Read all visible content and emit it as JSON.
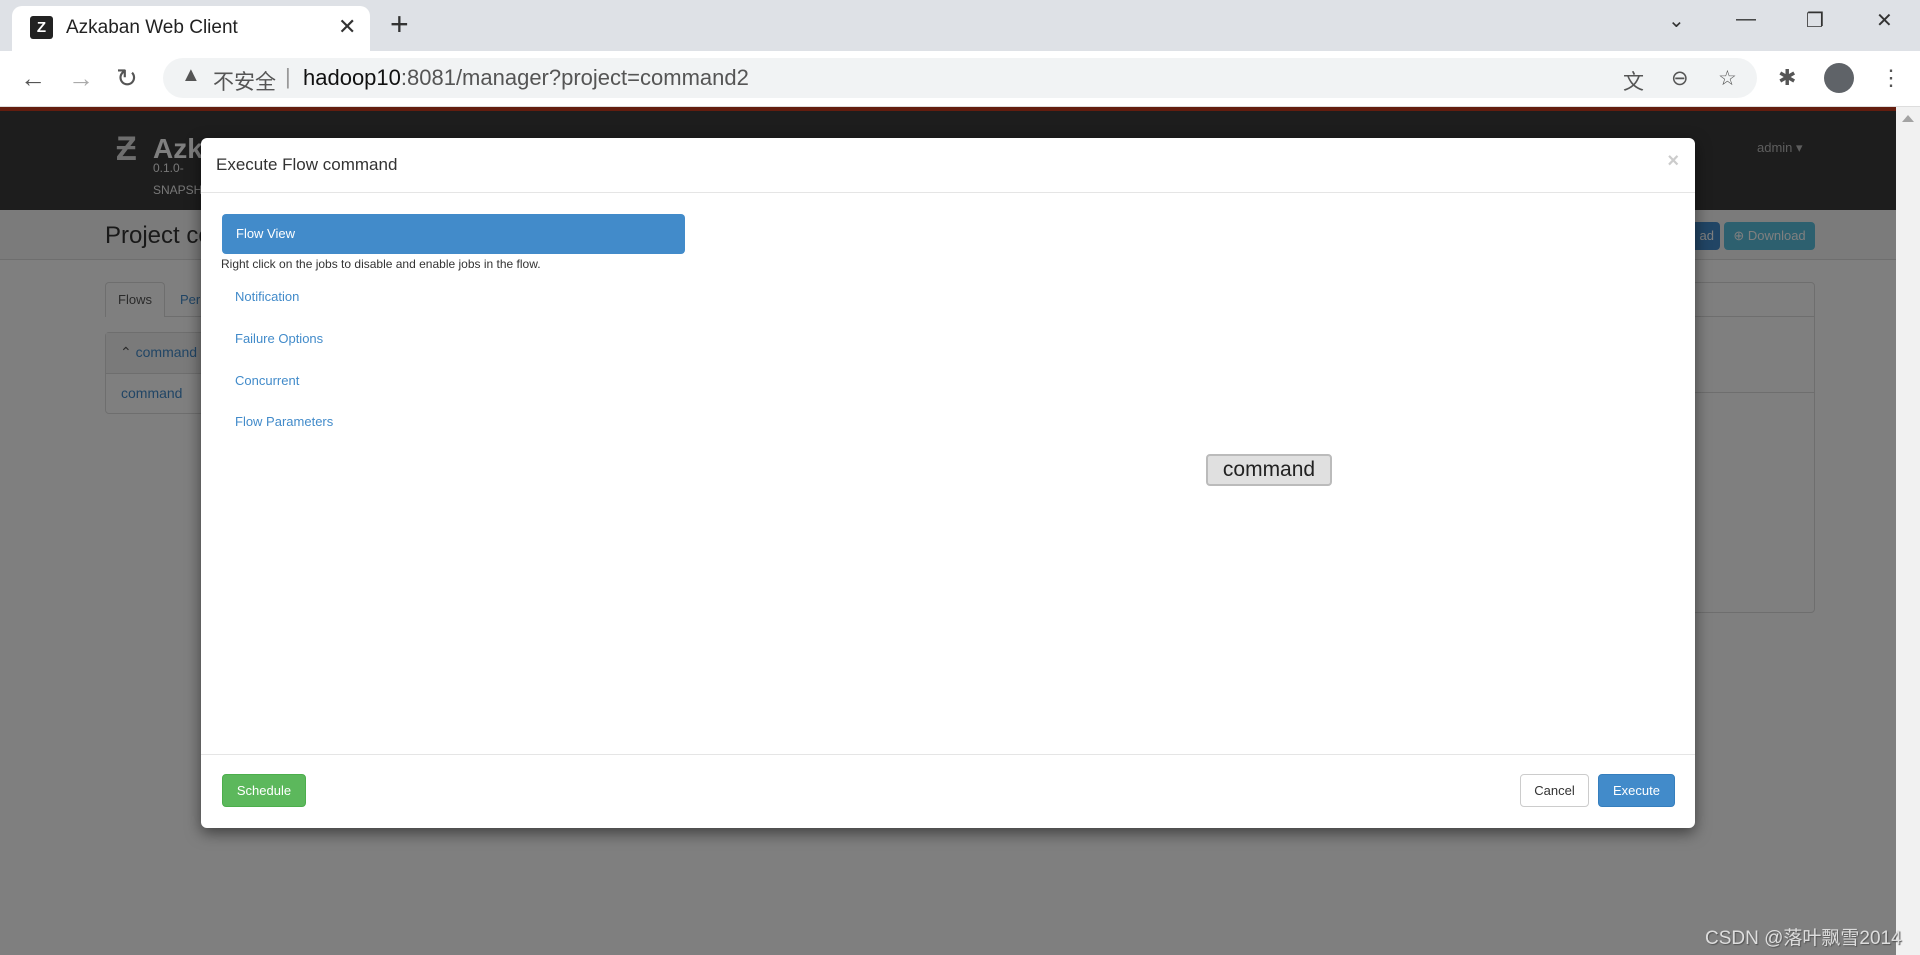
{
  "browser": {
    "tab_title": "Azkaban Web Client",
    "insecure_label": "不安全",
    "url_host": "hadoop10",
    "url_rest": ":8081/manager?project=command2"
  },
  "page": {
    "brand": "Azka",
    "version_line1": "0.1.0-",
    "version_line2": "SNAPSH",
    "user": "admin",
    "project_title": "Project co",
    "upload_label": "ad",
    "download_label": "Download",
    "tabs": [
      "Flows",
      "Per"
    ],
    "flow_group": "command",
    "flow_item": "command"
  },
  "modal": {
    "title": "Execute Flow command",
    "close": "×",
    "nav_active": "Flow View",
    "hint": "Right click on the jobs to disable and enable jobs in the flow.",
    "nav": [
      "Notification",
      "Failure Options",
      "Concurrent",
      "Flow Parameters"
    ],
    "node": "command",
    "schedule_label": "Schedule",
    "cancel_label": "Cancel",
    "execute_label": "Execute"
  },
  "watermark": "CSDN @落叶飘雪2014",
  "colors": {
    "primary": "#428bca",
    "success": "#5cb85c",
    "info": "#5bc0de",
    "header_accent": "#c73a1e"
  }
}
